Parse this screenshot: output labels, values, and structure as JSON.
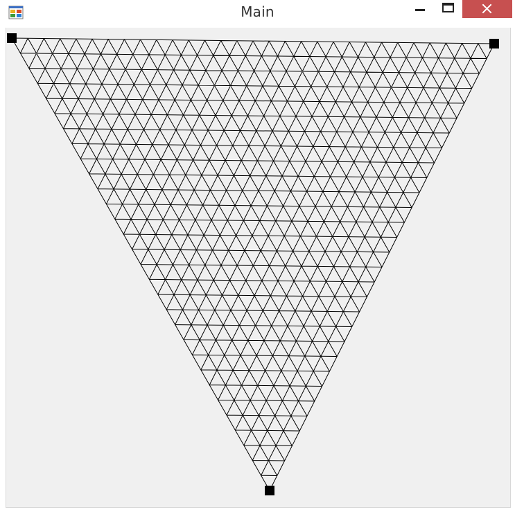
{
  "window": {
    "title": "Main",
    "icon": "application-icon",
    "controls": {
      "minimize_icon": "minimize-icon",
      "maximize_icon": "maximize-icon",
      "close_icon": "close-icon"
    },
    "close_color": "#c75050"
  },
  "canvas": {
    "background": "#f0f0f0",
    "mesh": {
      "shape": "triangle-mesh",
      "subdivisions": 30,
      "stroke_color": "#000000"
    },
    "handles": [
      {
        "name": "top-left-handle"
      },
      {
        "name": "top-right-handle"
      },
      {
        "name": "bottom-handle"
      }
    ]
  }
}
